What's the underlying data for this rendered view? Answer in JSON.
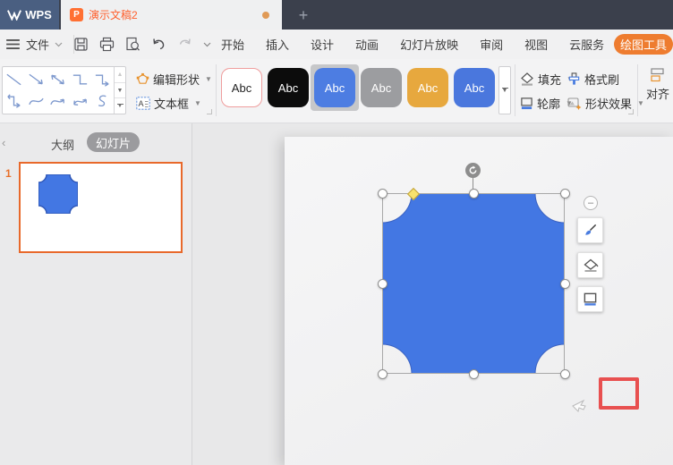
{
  "titlebar": {
    "logo_text": "WPS",
    "tab_title": "演示文稿2",
    "new_tab_label": "+"
  },
  "menubar": {
    "file_label": "文件",
    "tabs": [
      {
        "label": "开始"
      },
      {
        "label": "插入"
      },
      {
        "label": "设计"
      },
      {
        "label": "动画"
      },
      {
        "label": "幻灯片放映"
      },
      {
        "label": "审阅"
      },
      {
        "label": "视图"
      },
      {
        "label": "云服务"
      }
    ],
    "active_context_tab": "绘图工具"
  },
  "ribbon": {
    "edit_shape_label": "编辑形状",
    "text_box_label": "文本框",
    "style_presets": [
      {
        "label": "Abc",
        "style": "white-red-border",
        "selected": false
      },
      {
        "label": "Abc",
        "style": "black",
        "selected": false
      },
      {
        "label": "Abc",
        "style": "blue",
        "selected": true
      },
      {
        "label": "Abc",
        "style": "gray",
        "selected": false
      },
      {
        "label": "Abc",
        "style": "gold",
        "selected": false
      },
      {
        "label": "Abc",
        "style": "blue2",
        "selected": false
      }
    ],
    "fill_label": "填充",
    "outline_label": "轮廓",
    "format_painter_label": "格式刷",
    "shape_effects_label": "形状效果",
    "align_label": "对齐"
  },
  "sidebar": {
    "collapse_label": "‹",
    "outline_tab": "大纲",
    "slides_tab": "幻灯片",
    "slides": [
      {
        "number": "1",
        "shape": "plaque"
      }
    ]
  },
  "canvas": {
    "selected_shape": "plaque",
    "shape_fill": "#4377e3"
  },
  "icons": {
    "quick_access": [
      "hamburger-icon",
      "save-icon",
      "print-icon",
      "print-preview-icon",
      "undo-icon",
      "redo-icon",
      "customize-chevron-icon"
    ],
    "ribbon": [
      "edit-shape-icon",
      "text-box-icon",
      "fill-bucket-icon",
      "outline-icon",
      "format-painter-icon",
      "shape-effects-icon",
      "align-icon"
    ],
    "shape_gallery": [
      "line",
      "arrow",
      "double-arrow",
      "elbow-connector",
      "elbow-arrow",
      "elbow-double-arrow",
      "curved-connector",
      "curved-arrow",
      "curved-double-arrow",
      "freeform-s"
    ],
    "floating": [
      "collapse-minus-icon",
      "quick-style-brush-icon",
      "quick-fill-icon",
      "quick-outline-icon"
    ],
    "selection": [
      "rotate-handle-icon",
      "adjust-diamond-handle"
    ]
  },
  "colors": {
    "titlebar-bg": "#3b404c",
    "logo-bg": "#4a5f81",
    "accent-orange": "#ee7c2f",
    "tab-text-orange": "#ff5e2b",
    "shape-blue": "#4377e3",
    "shape-stroke": "#3a62c2",
    "annotation-red": "#e85050",
    "gallery-stroke": "#7e99ce",
    "thumb-border": "#e8692b",
    "preset_blue": "#4d7de2",
    "preset_gray": "#9c9da0",
    "preset_gold": "#e7a83e",
    "unsaved_dot": "#e09a56"
  }
}
